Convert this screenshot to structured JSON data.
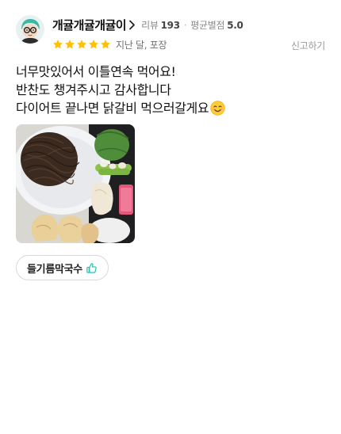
{
  "review": {
    "author": {
      "nickname": "개귤개귤개귤이",
      "review_count_label": "리뷰",
      "review_count": "193",
      "avg_rating_label": "평균별점",
      "avg_rating": "5.0"
    },
    "rating": {
      "stars": 5,
      "max_stars": 5,
      "star_color": "#ffc107",
      "order_info": "지난 달, 포장"
    },
    "report_label": "신고하기",
    "text_lines": [
      "너무맛있어서 이틀연속 먹어요!",
      "반찬도 챙겨주시고 감사합니다",
      "다이어트 끝나면 닭갈비 먹으러갈게요"
    ],
    "emoji": "smiling-face-emoji",
    "photo": {
      "icon": "food-photo"
    },
    "menu_tag": {
      "name": "들기름막국수",
      "icon": "thumbs-up-icon",
      "accent": "#2ac1bc"
    }
  }
}
